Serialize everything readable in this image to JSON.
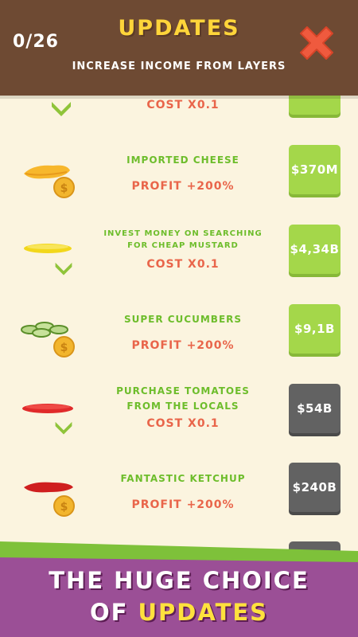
{
  "header": {
    "counter": "0/26",
    "title": "UPDATES",
    "subtitle": "INCREASE INCOME FROM LAYERS"
  },
  "items": [
    {
      "name": "",
      "effect": "COST X0.1",
      "price": "",
      "price_style": "green",
      "icon": "chevron-down-icon"
    },
    {
      "name": "IMPORTED CHEESE",
      "effect": "PROFIT +200%",
      "price": "$370M",
      "price_style": "green",
      "icon": "cheese-layer-icon"
    },
    {
      "name_lines": [
        "INVEST MONEY ON SEARCHING",
        "FOR CHEAP MUSTARD"
      ],
      "effect": "COST X0.1",
      "price": "$4,34B",
      "price_style": "green",
      "icon": "mustard-layer-icon"
    },
    {
      "name": "SUPER CUCUMBERS",
      "effect": "PROFIT +200%",
      "price": "$9,1B",
      "price_style": "green",
      "icon": "cucumber-layer-icon"
    },
    {
      "name_lines": [
        "PURCHASE TOMATOES",
        "FROM THE LOCALS"
      ],
      "effect": "COST X0.1",
      "price": "$54B",
      "price_style": "gray",
      "icon": "tomato-layer-icon"
    },
    {
      "name": "FANTASTIC KETCHUP",
      "effect": "PROFIT +200%",
      "price": "$240B",
      "price_style": "gray",
      "icon": "ketchup-layer-icon"
    }
  ],
  "banner": {
    "line1": "THE HUGE CHOICE",
    "line2_prefix": "OF ",
    "line2_highlight": "UPDATES"
  },
  "colors": {
    "header_bg": "#6e4a33",
    "page_bg": "#fbf4df",
    "title": "#ffd53a",
    "name": "#6dbd2b",
    "effect": "#e9654a",
    "price_green": "#a4d74a",
    "price_gray": "#626262",
    "banner_purple": "#9b4f96",
    "banner_green": "#7ec13a",
    "close_red": "#ef5a3e"
  }
}
